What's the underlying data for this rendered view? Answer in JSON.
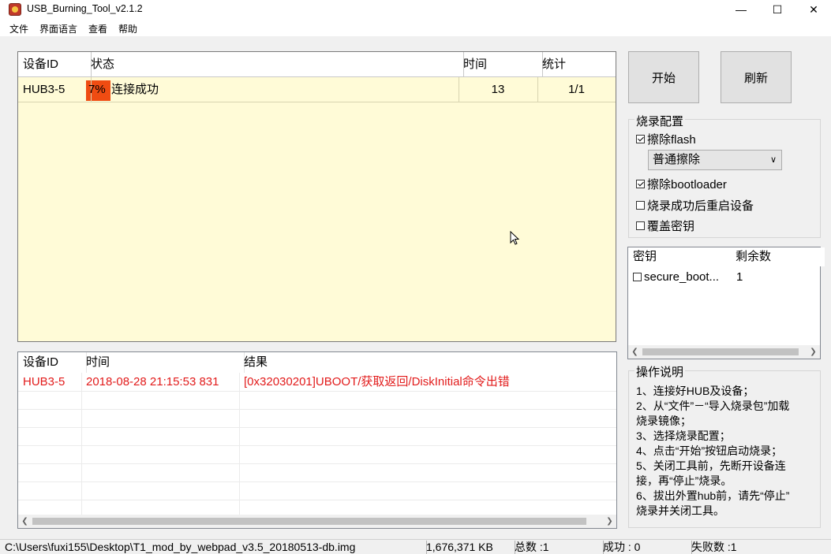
{
  "window": {
    "title": "USB_Burning_Tool_v2.1.2"
  },
  "menu": [
    "文件",
    "界面语言",
    "查看",
    "帮助"
  ],
  "device_table": {
    "headers": [
      "设备ID",
      "状态",
      "时间",
      "统计"
    ],
    "rows": [
      {
        "id": "HUB3-5",
        "progress_label": "7%",
        "status": "连接成功",
        "time": "13",
        "stats": "1/1",
        "progress": 0.07
      }
    ]
  },
  "buttons": {
    "start": "开始",
    "refresh": "刷新"
  },
  "config": {
    "title": "烧录配置",
    "erase_flash": {
      "label": "擦除flash",
      "checked": true
    },
    "erase_mode": {
      "value": "普通擦除"
    },
    "erase_bootloader": {
      "label": "擦除bootloader",
      "checked": true
    },
    "reboot_after": {
      "label": "烧录成功后重启设备",
      "checked": false
    },
    "overwrite_key": {
      "label": "覆盖密钥",
      "checked": false
    }
  },
  "key_table": {
    "headers": [
      "密钥",
      "剩余数"
    ],
    "rows": [
      {
        "name": "secure_boot...",
        "remaining": "1",
        "checked": false
      }
    ]
  },
  "help": {
    "title": "操作说明",
    "lines": [
      "1、连接好HUB及设备；",
      "2、从“文件”－“导入烧录包”加载",
      "烧录镜像；",
      "3、选择烧录配置；",
      "4、点击“开始”按钮启动烧录；",
      "5、关闭工具前，先断开设备连",
      "接，再“停止”烧录。",
      "6、拔出外置hub前，请先“停止”",
      "烧录并关闭工具。"
    ]
  },
  "log_table": {
    "headers": [
      "设备ID",
      "时间",
      "结果"
    ],
    "rows": [
      {
        "id": "HUB3-5",
        "time": "2018-08-28 21:15:53 831",
        "result": "[0x32030201]UBOOT/获取返回/DiskInitial命令出错"
      }
    ]
  },
  "status_bar": {
    "path": "C:\\Users\\fuxi155\\Desktop\\T1_mod_by_webpad_v3.5_20180513-db.img",
    "size": "1,676,371 KB",
    "total": "总数 :1",
    "success": "成功 : 0",
    "failed": "失败数 :1"
  },
  "colors": {
    "progress": "#ef4c12",
    "error_text": "#e21b1b",
    "list_bg": "#fffbd7"
  }
}
